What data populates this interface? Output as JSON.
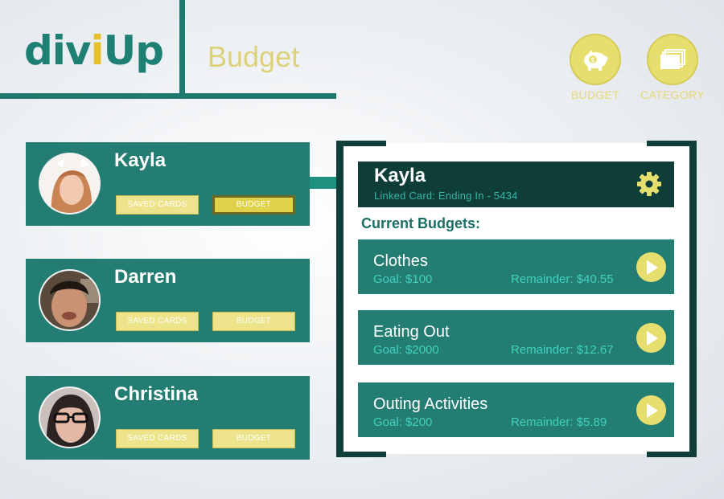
{
  "header": {
    "logo": {
      "part1": "div",
      "accent": "i",
      "part2": "Up"
    },
    "section_title": "Budget",
    "buttons": [
      {
        "label": "BUDGET",
        "icon": "piggy-bank-icon"
      },
      {
        "label": "CATEGORY",
        "icon": "cards-stack-icon"
      }
    ]
  },
  "users": [
    {
      "name": "Kayla",
      "saved_cards_label": "SAVED CARDS",
      "budget_label": "BUDGET",
      "budget_active": true
    },
    {
      "name": "Darren",
      "saved_cards_label": "SAVED CARDS",
      "budget_label": "BUDGET",
      "budget_active": false
    },
    {
      "name": "Christina",
      "saved_cards_label": "SAVED CARDS",
      "budget_label": "BUDGET",
      "budget_active": false
    }
  ],
  "detail": {
    "name": "Kayla",
    "linked_card": "Linked Card: Ending In - 5434",
    "current_budgets_label": "Current Budgets:",
    "budgets": [
      {
        "name": "Clothes",
        "goal": "Goal: $100",
        "remainder": "Remainder: $40.55"
      },
      {
        "name": "Eating Out",
        "goal": "Goal: $2000",
        "remainder": "Remainder: $12.67"
      },
      {
        "name": "Outing Activities",
        "goal": "Goal: $200",
        "remainder": "Remainder: $5.89"
      }
    ]
  },
  "colors": {
    "teal": "#237d72",
    "dark_teal": "#0f3e38",
    "yellow": "#e6df6e",
    "accent_text": "#44d1bd"
  }
}
